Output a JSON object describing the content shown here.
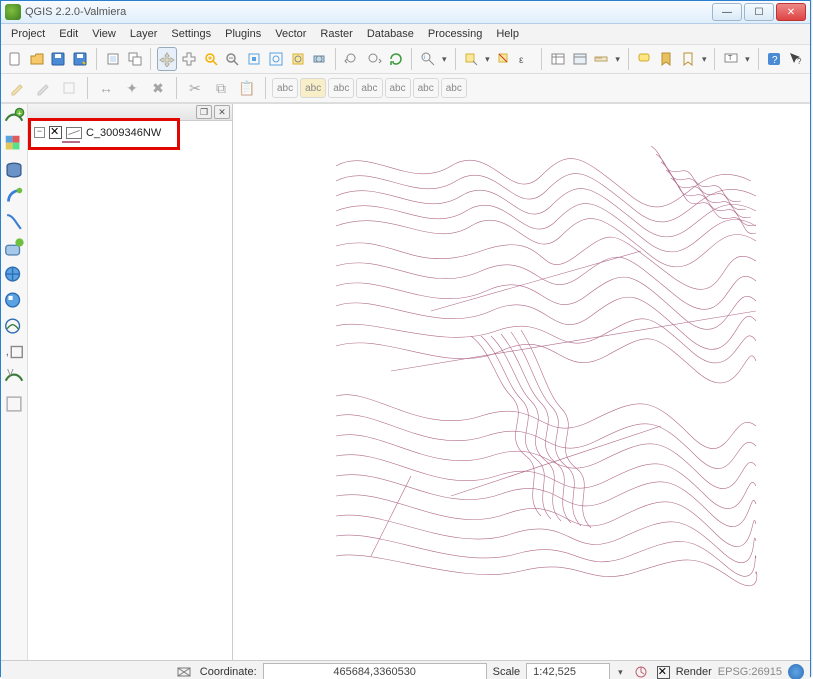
{
  "window": {
    "title": "QGIS 2.2.0-Valmiera"
  },
  "menu": {
    "items": [
      "Project",
      "Edit",
      "View",
      "Layer",
      "Settings",
      "Plugins",
      "Vector",
      "Raster",
      "Database",
      "Processing",
      "Help"
    ]
  },
  "toolbar2_labels": [
    "abc",
    "abc",
    "abc",
    "abc",
    "abc",
    "abc",
    "abc"
  ],
  "layers": {
    "items": [
      {
        "name": "C_3009346NW",
        "visible": true,
        "expanded": true
      }
    ]
  },
  "status": {
    "coordinate_label": "Coordinate:",
    "coordinate_value": "465684,3360530",
    "scale_label": "Scale",
    "scale_value": "1:42,525",
    "render_label": "Render",
    "crs": "EPSG:26915"
  }
}
